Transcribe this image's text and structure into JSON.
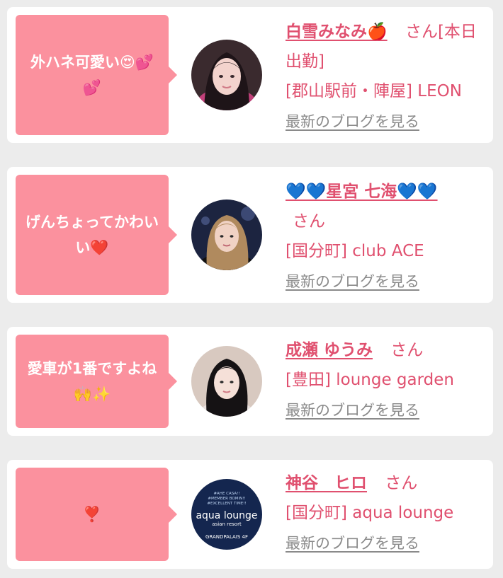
{
  "entries": [
    {
      "comment": "外ハネ可愛い😍💕💕",
      "name": "白雪みなみ🍎",
      "honorific": "さん[本日出勤]",
      "shop": "[郡山駅前・陣屋] LEON",
      "blog_link": "最新のブログを見る"
    },
    {
      "comment": "げんちょってかわいい❤️",
      "name": "💙💙星宮 七海💙💙",
      "honorific": "さん",
      "shop": "[国分町] club ACE",
      "blog_link": "最新のブログを見る"
    },
    {
      "comment": "愛車が1番ですよね🙌✨",
      "name": "成瀬 ゆうみ",
      "honorific": "さん",
      "shop": "[豊田] lounge garden",
      "blog_link": "最新のブログを見る"
    },
    {
      "comment": "❣️",
      "name": "神谷　ヒロ",
      "honorific": "さん",
      "shop": "[国分町] aqua lounge",
      "blog_link": "最新のブログを見る"
    }
  ],
  "avatar_logo": {
    "line1": "#AHE CASA!!",
    "line2": "#MEMBER BOMIN!!",
    "line3": "#EXCELLENT TIME!!",
    "title": "aqua lounge",
    "subtitle": "asian resort",
    "footer": "GRANDPALAIS 4F"
  },
  "colors": {
    "bubble": "#fb919e",
    "name_text": "#e0506f",
    "link_text": "#8a8a8a",
    "card_bg": "#ffffff",
    "page_bg": "#ececec"
  }
}
